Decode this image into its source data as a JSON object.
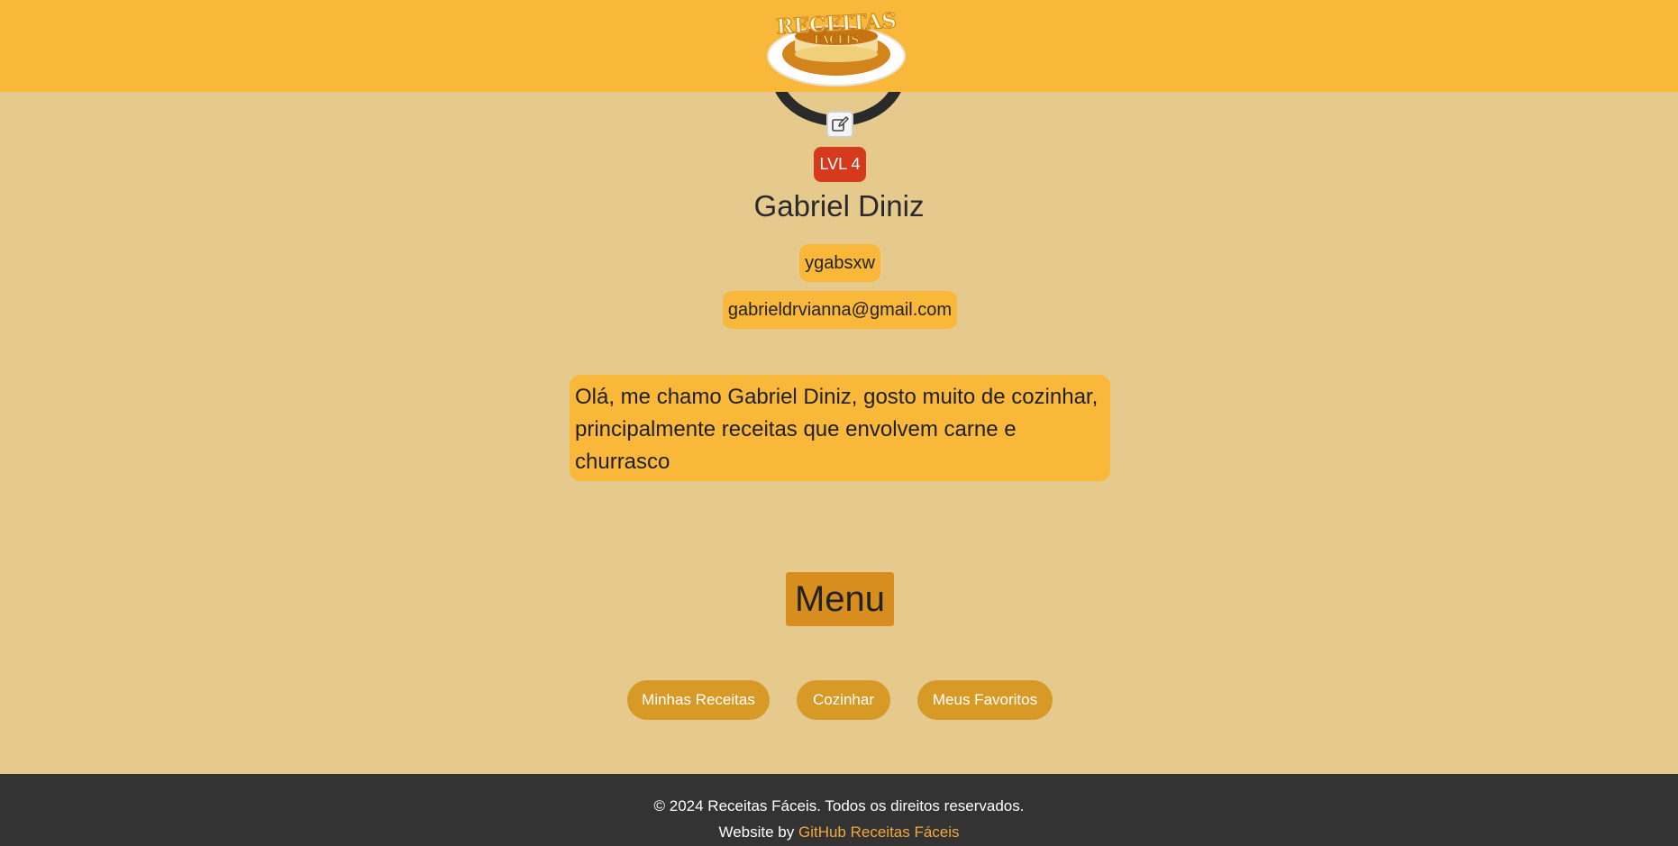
{
  "header": {
    "logo_line1": "RECEITAS",
    "logo_line2": "FÁCEIS"
  },
  "profile": {
    "level": "LVL 4",
    "name": "Gabriel Diniz",
    "username": "ygabsxw",
    "email": "gabrieldrvianna@gmail.com",
    "bio": "Olá, me chamo Gabriel Diniz, gosto muito de cozinhar, principalmente receitas que envolvem carne e churrasco"
  },
  "menu": {
    "title": "Menu",
    "buttons": [
      {
        "label": "Minhas Receitas"
      },
      {
        "label": "Cozinhar"
      },
      {
        "label": "Meus Favoritos"
      }
    ]
  },
  "footer": {
    "copyright": "© 2024 Receitas Fáceis. Todos os direitos reservados.",
    "credit_prefix": "Website by",
    "credit_link": "GitHub Receitas Fáceis"
  },
  "colors": {
    "page_bg": "#e6c98d",
    "header_bg": "#f9b83a",
    "badge_bg": "#d63a1d",
    "button_bg": "#d89a26",
    "footer_bg": "#333333",
    "link": "#f0a93a"
  },
  "icons": {
    "edit": "edit-icon"
  }
}
